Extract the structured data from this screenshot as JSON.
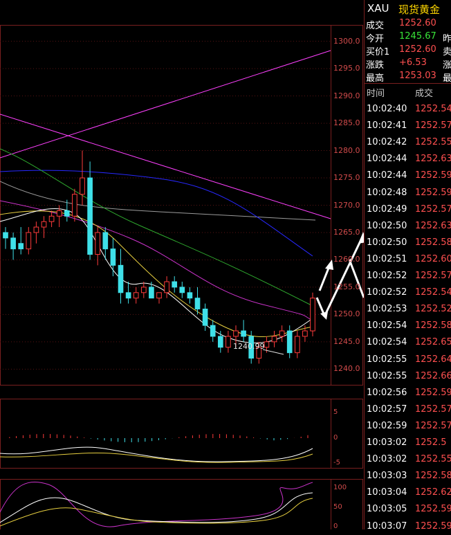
{
  "chart_data": {
    "type": "candlestick",
    "y_axis_ticks": [
      "1300.0",
      "1295.0",
      "1290.0",
      "1285.0",
      "1280.0",
      "1275.0",
      "1270.0",
      "1265.0",
      "1260.0",
      "1255.0",
      "1250.0",
      "1245.0",
      "1240.0"
    ],
    "ylim": [
      1237,
      1303
    ],
    "low_annotation": "1240.99",
    "candles": [
      {
        "o": 1265,
        "h": 1266,
        "l": 1262,
        "c": 1264
      },
      {
        "o": 1264,
        "h": 1265,
        "l": 1260,
        "c": 1262
      },
      {
        "o": 1263,
        "h": 1266,
        "l": 1261,
        "c": 1262
      },
      {
        "o": 1262,
        "h": 1266,
        "l": 1261,
        "c": 1265
      },
      {
        "o": 1265,
        "h": 1267,
        "l": 1263,
        "c": 1266
      },
      {
        "o": 1266,
        "h": 1268,
        "l": 1264,
        "c": 1267
      },
      {
        "o": 1267,
        "h": 1269,
        "l": 1266,
        "c": 1268
      },
      {
        "o": 1268,
        "h": 1270,
        "l": 1266,
        "c": 1269
      },
      {
        "o": 1269,
        "h": 1271,
        "l": 1267,
        "c": 1268
      },
      {
        "o": 1268,
        "h": 1273,
        "l": 1267,
        "c": 1272
      },
      {
        "o": 1272,
        "h": 1280,
        "l": 1270,
        "c": 1275
      },
      {
        "o": 1275,
        "h": 1278,
        "l": 1260,
        "c": 1261
      },
      {
        "o": 1261,
        "h": 1266,
        "l": 1259,
        "c": 1265
      },
      {
        "o": 1265,
        "h": 1266,
        "l": 1260,
        "c": 1262
      },
      {
        "o": 1262,
        "h": 1264,
        "l": 1257,
        "c": 1259
      },
      {
        "o": 1259,
        "h": 1262,
        "l": 1252,
        "c": 1254
      },
      {
        "o": 1254,
        "h": 1256,
        "l": 1252,
        "c": 1253
      },
      {
        "o": 1253,
        "h": 1255,
        "l": 1252,
        "c": 1254
      },
      {
        "o": 1254,
        "h": 1256,
        "l": 1253,
        "c": 1255
      },
      {
        "o": 1255,
        "h": 1256,
        "l": 1253,
        "c": 1253
      },
      {
        "o": 1253,
        "h": 1254,
        "l": 1252,
        "c": 1254
      },
      {
        "o": 1254,
        "h": 1257,
        "l": 1253,
        "c": 1256
      },
      {
        "o": 1256,
        "h": 1257,
        "l": 1254,
        "c": 1255
      },
      {
        "o": 1255,
        "h": 1256,
        "l": 1253,
        "c": 1254
      },
      {
        "o": 1254,
        "h": 1255,
        "l": 1252,
        "c": 1253
      },
      {
        "o": 1253,
        "h": 1255,
        "l": 1250,
        "c": 1251
      },
      {
        "o": 1251,
        "h": 1252,
        "l": 1247,
        "c": 1248
      },
      {
        "o": 1248,
        "h": 1249,
        "l": 1245,
        "c": 1246
      },
      {
        "o": 1246,
        "h": 1247,
        "l": 1243,
        "c": 1244
      },
      {
        "o": 1244,
        "h": 1247,
        "l": 1243,
        "c": 1246
      },
      {
        "o": 1246,
        "h": 1248,
        "l": 1244,
        "c": 1247
      },
      {
        "o": 1247,
        "h": 1249,
        "l": 1245,
        "c": 1246
      },
      {
        "o": 1246,
        "h": 1247,
        "l": 1241,
        "c": 1242
      },
      {
        "o": 1242,
        "h": 1245,
        "l": 1241,
        "c": 1244
      },
      {
        "o": 1244,
        "h": 1246,
        "l": 1243,
        "c": 1245
      },
      {
        "o": 1245,
        "h": 1247,
        "l": 1244,
        "c": 1246
      },
      {
        "o": 1246,
        "h": 1248,
        "l": 1245,
        "c": 1247
      },
      {
        "o": 1247,
        "h": 1248,
        "l": 1242,
        "c": 1243
      },
      {
        "o": 1243,
        "h": 1247,
        "l": 1242,
        "c": 1246
      },
      {
        "o": 1246,
        "h": 1248,
        "l": 1245,
        "c": 1247
      },
      {
        "o": 1247,
        "h": 1254,
        "l": 1246,
        "c": 1253
      }
    ],
    "sub1_ticks": [
      "5",
      "0",
      "-5"
    ],
    "sub2_ticks": [
      "100",
      "50",
      "0"
    ],
    "colors": {
      "up": "#ff3b3b",
      "down": "#3fe0e8",
      "ma1": "#ffffff",
      "ma2": "#e8d040",
      "ma3": "#cc33cc",
      "ma4": "#2ea82e",
      "ma5": "#2828ff",
      "ma6": "#9c9c9c",
      "trend": "#ff40ff",
      "arrow": "#ffffff"
    }
  },
  "quote_panel": {
    "symbol": "XAU",
    "name": "现货黄金",
    "rows": [
      {
        "label": "成交",
        "value": "1252.60",
        "color": "#ff5050",
        "label2": ""
      },
      {
        "label": "今开",
        "value": "1245.67",
        "color": "#39e639",
        "label2": "昨"
      },
      {
        "label": "买价1",
        "value": "1252.60",
        "color": "#ff5050",
        "label2": "卖"
      },
      {
        "label": "涨跌",
        "value": "+6.53",
        "color": "#ff5050",
        "label2": "涨"
      },
      {
        "label": "最高",
        "value": "1253.03",
        "color": "#ff5050",
        "label2": "最"
      }
    ],
    "tick_header": {
      "time": "时间",
      "price": "成交"
    },
    "ticks": [
      {
        "time": "10:02:40",
        "price": "1252.54"
      },
      {
        "time": "10:02:41",
        "price": "1252.57"
      },
      {
        "time": "10:02:42",
        "price": "1252.55"
      },
      {
        "time": "10:02:44",
        "price": "1252.63"
      },
      {
        "time": "10:02:44",
        "price": "1252.59"
      },
      {
        "time": "10:02:48",
        "price": "1252.59"
      },
      {
        "time": "10:02:49",
        "price": "1252.57"
      },
      {
        "time": "10:02:50",
        "price": "1252.63"
      },
      {
        "time": "10:02:50",
        "price": "1252.58"
      },
      {
        "time": "10:02:51",
        "price": "1252.60"
      },
      {
        "time": "10:02:52",
        "price": "1252.57"
      },
      {
        "time": "10:02:52",
        "price": "1252.54"
      },
      {
        "time": "10:02:53",
        "price": "1252.52"
      },
      {
        "time": "10:02:54",
        "price": "1252.58"
      },
      {
        "time": "10:02:54",
        "price": "1252.65"
      },
      {
        "time": "10:02:55",
        "price": "1252.64"
      },
      {
        "time": "10:02:55",
        "price": "1252.66"
      },
      {
        "time": "10:02:56",
        "price": "1252.59"
      },
      {
        "time": "10:02:57",
        "price": "1252.57"
      },
      {
        "time": "10:02:59",
        "price": "1252.57"
      },
      {
        "time": "10:03:02",
        "price": "1252.5"
      },
      {
        "time": "10:03:02",
        "price": "1252.55"
      },
      {
        "time": "10:03:03",
        "price": "1252.58"
      },
      {
        "time": "10:03:04",
        "price": "1252.62"
      },
      {
        "time": "10:03:05",
        "price": "1252.59"
      },
      {
        "time": "10:03:07",
        "price": "1252.59"
      }
    ]
  }
}
